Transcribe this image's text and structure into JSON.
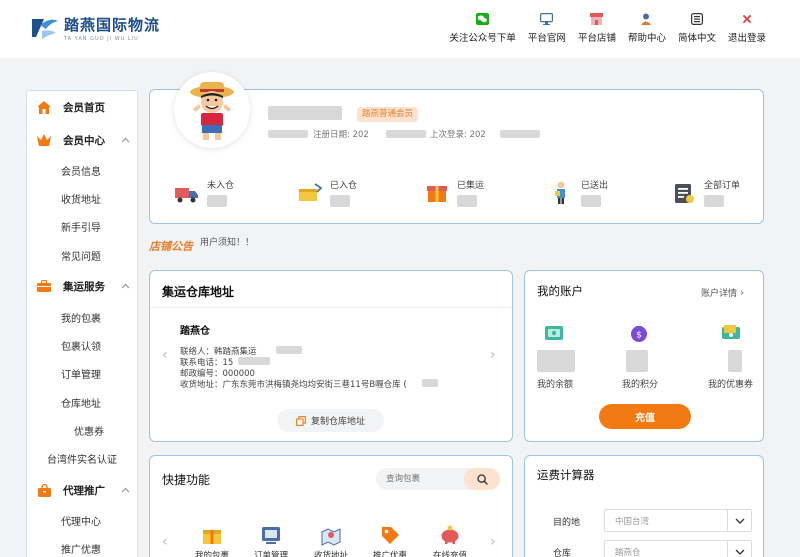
{
  "brand": {
    "name_cn": "踏燕国际物流",
    "name_en": "TA YAN GUO JI WU LIU"
  },
  "topnav": [
    {
      "label": "关注公众号下单",
      "icon": "wechat-icon",
      "color": "#1aad19"
    },
    {
      "label": "平台官网",
      "icon": "monitor-icon",
      "color": "#4a6ea9"
    },
    {
      "label": "平台店铺",
      "icon": "store-icon",
      "color": "#e05a5a"
    },
    {
      "label": "帮助中心",
      "icon": "help-user-icon",
      "color": "#e7772b"
    },
    {
      "label": "简体中文",
      "icon": "language-icon",
      "color": "#333333"
    },
    {
      "label": "退出登录",
      "icon": "close-icon",
      "color": "#e03c3c"
    }
  ],
  "sidebar": {
    "home": "会员首页",
    "member_center": "会员中心",
    "member_items": [
      "会员信息",
      "收货地址",
      "新手引导",
      "常见问题"
    ],
    "consolidation": "集运服务",
    "consolidation_items": [
      "我的包裹",
      "包裹认领",
      "订单管理",
      "仓库地址",
      "优惠券",
      "台湾件实名认证"
    ],
    "agency": "代理推广",
    "agency_items": [
      "代理中心",
      "推广优惠"
    ]
  },
  "profile": {
    "badge": "踏燕普通会员",
    "register_label": "注册日期: 202",
    "last_login_label": "上次登录: 202",
    "stats": [
      {
        "label": "未入仓",
        "icon": "truck-icon"
      },
      {
        "label": "已入仓",
        "icon": "warehouse-box-icon"
      },
      {
        "label": "已集运",
        "icon": "gift-box-icon"
      },
      {
        "label": "已送出",
        "icon": "delivery-person-icon"
      },
      {
        "label": "全部订单",
        "icon": "orders-list-icon"
      }
    ]
  },
  "notice": {
    "title": "店铺公告",
    "text": "用户须知！！"
  },
  "warehouse": {
    "title": "集运仓库地址",
    "name": "踏燕仓",
    "contact": "联络人：韩踏燕集运",
    "phone": "联系电话：15",
    "postcode": "邮政编号：000000",
    "address": "收货地址：广东东莞市洪梅镇尧均均安街三巷11号B喱仓库 (",
    "copy_button": "复制仓库地址"
  },
  "account": {
    "title": "我的账户",
    "detail_link": "账户详情",
    "items": [
      {
        "label": "我的余额",
        "icon": "balance-icon"
      },
      {
        "label": "我的积分",
        "icon": "points-bag-icon"
      },
      {
        "label": "我的优惠券",
        "icon": "coupon-icon"
      }
    ],
    "recharge_button": "充值"
  },
  "quick": {
    "title": "快捷功能",
    "search_placeholder": "查询包裹",
    "items": [
      {
        "label": "我的包裹",
        "icon": "package-icon"
      },
      {
        "label": "订单管理",
        "icon": "order-manage-icon"
      },
      {
        "label": "收货地址",
        "icon": "map-address-icon"
      },
      {
        "label": "推广优惠",
        "icon": "promo-tag-icon"
      },
      {
        "label": "在线充值",
        "icon": "piggy-bank-icon"
      }
    ]
  },
  "calculator": {
    "title": "运费计算器",
    "destination_label": "目的地",
    "destination_value": "中国台湾",
    "warehouse_label": "仓库",
    "warehouse_value": "踏燕仓"
  },
  "colors": {
    "accent": "#f37a12",
    "card_border": "#9fc3e3",
    "brand_blue": "#1f4e8c"
  }
}
